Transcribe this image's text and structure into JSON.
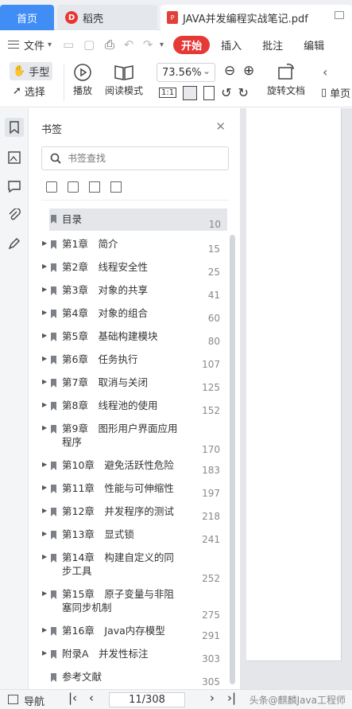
{
  "tabs": {
    "home": "首页",
    "docer": "稻壳",
    "document": "JAVA并发编程实战笔记.pdf"
  },
  "menu": {
    "file": "文件",
    "start": "开始",
    "insert": "插入",
    "annotate": "批注",
    "edit": "编辑"
  },
  "ribbon": {
    "hand": "手型",
    "select": "选择",
    "play": "播放",
    "read_mode": "阅读模式",
    "zoom": "73.56%",
    "rotate": "旋转文档",
    "single_page": "单页"
  },
  "panel": {
    "title": "书签",
    "search_placeholder": "书签查找"
  },
  "bookmarks": [
    {
      "label": "目录",
      "page": "10",
      "expandable": false,
      "selected": true
    },
    {
      "label": "第1章　简介",
      "page": "15",
      "expandable": true
    },
    {
      "label": "第2章　线程安全性",
      "page": "25",
      "expandable": true
    },
    {
      "label": "第3章　对象的共享",
      "page": "41",
      "expandable": true
    },
    {
      "label": "第4章　对象的组合",
      "page": "60",
      "expandable": true
    },
    {
      "label": "第5章　基础构建模块",
      "page": "80",
      "expandable": true
    },
    {
      "label": "第6章　任务执行",
      "page": "107",
      "expandable": true
    },
    {
      "label": "第7章　取消与关闭",
      "page": "125",
      "expandable": true
    },
    {
      "label": "第8章　线程池的使用",
      "page": "152",
      "expandable": true
    },
    {
      "label": "第9章　图形用户界面应用程序",
      "page": "170",
      "expandable": true
    },
    {
      "label": "第10章　避免活跃性危险",
      "page": "183",
      "expandable": true
    },
    {
      "label": "第11章　性能与可伸缩性",
      "page": "197",
      "expandable": true
    },
    {
      "label": "第12章　并发程序的测试",
      "page": "218",
      "expandable": true
    },
    {
      "label": "第13章　显式锁",
      "page": "241",
      "expandable": true
    },
    {
      "label": "第14章　构建自定义的同步工具",
      "page": "252",
      "expandable": true
    },
    {
      "label": "第15章　原子变量与非阻塞同步机制",
      "page": "275",
      "expandable": true
    },
    {
      "label": "第16章　Java内存模型",
      "page": "291",
      "expandable": true
    },
    {
      "label": "附录A　并发性标注",
      "page": "303",
      "expandable": true
    },
    {
      "label": "参考文献",
      "page": "305",
      "expandable": false
    }
  ],
  "status": {
    "nav": "导航",
    "page_indicator": "11/308",
    "watermark": "头条@麒麟Java工程师"
  }
}
